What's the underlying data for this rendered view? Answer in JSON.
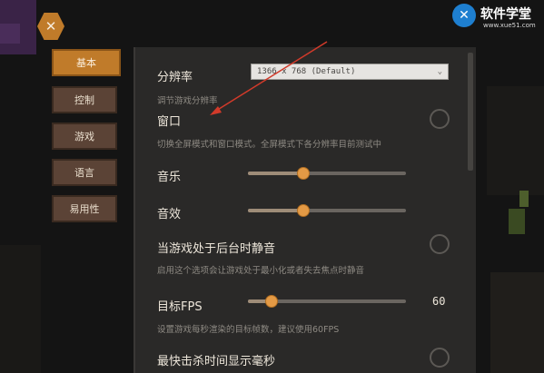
{
  "close_icon": "close-icon",
  "tabs": [
    {
      "label": "基本",
      "active": true
    },
    {
      "label": "控制",
      "active": false
    },
    {
      "label": "游戏",
      "active": false
    },
    {
      "label": "语言",
      "active": false
    },
    {
      "label": "易用性",
      "active": false
    }
  ],
  "settings": {
    "resolution": {
      "label": "分辨率",
      "value": "1366 x 768 (Default)",
      "description": "调节游戏分辨率"
    },
    "window": {
      "label": "窗口",
      "description": "切换全屏模式和窗口模式。全屏模式下各分辨率目前测试中",
      "checked": false
    },
    "music": {
      "label": "音乐",
      "level": 0.35
    },
    "sfx": {
      "label": "音效",
      "level": 0.35
    },
    "mute_background": {
      "label": "当游戏处于后台时静音",
      "description": "启用这个选项会让游戏处于最小化或者失去焦点时静音",
      "checked": false
    },
    "target_fps": {
      "label": "目标FPS",
      "value": "60",
      "description": "设置游戏每秒渲染的目标帧数，建议使用60FPS",
      "level": 0.15
    },
    "fastest_kill": {
      "label": "最快击杀时间显示毫秒",
      "checked": false
    }
  },
  "watermark": {
    "name": "软件学堂",
    "url": "www.xue51.com",
    "logo_glyph": "✕"
  },
  "colors": {
    "accent": "#c07b2a",
    "tab_inactive": "#5b4336",
    "panel": "#2a2928",
    "slider_knob": "#e49a45",
    "arrow": "#d23a2a"
  }
}
